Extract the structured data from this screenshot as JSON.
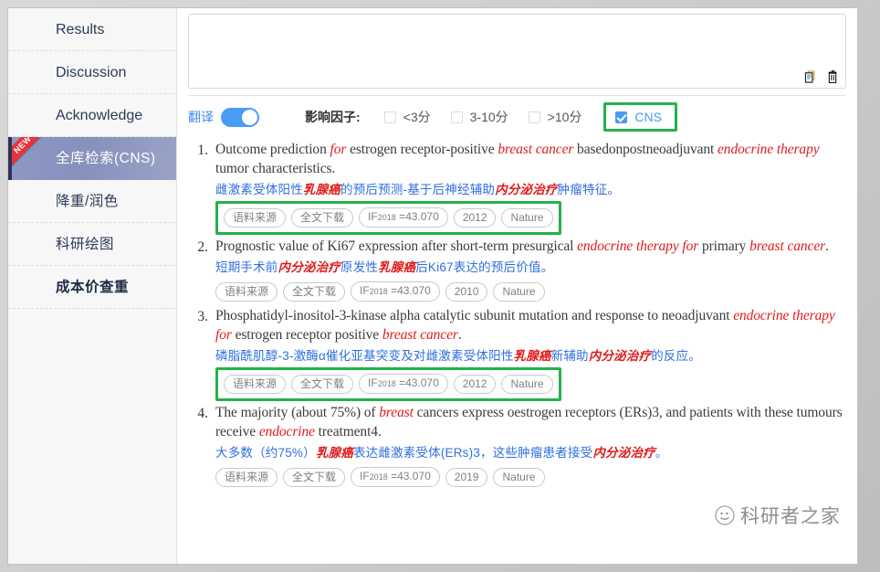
{
  "sidebar": {
    "items": [
      {
        "label": "Results",
        "active": false,
        "badge": "",
        "bold": false,
        "cjk": false
      },
      {
        "label": "Discussion",
        "active": false,
        "badge": "",
        "bold": false,
        "cjk": false
      },
      {
        "label": "Acknowledge",
        "active": false,
        "badge": "",
        "bold": false,
        "cjk": false
      },
      {
        "label": "全库检索(CNS)",
        "active": true,
        "badge": "NEW",
        "bold": false,
        "cjk": true
      },
      {
        "label": "降重/润色",
        "active": false,
        "badge": "",
        "bold": false,
        "cjk": true
      },
      {
        "label": "科研绘图",
        "active": false,
        "badge": "",
        "bold": false,
        "cjk": true
      },
      {
        "label": "成本价查重",
        "active": false,
        "badge": "",
        "bold": true,
        "cjk": true
      }
    ]
  },
  "editor": {
    "value": "",
    "placeholder": "",
    "tools": [
      {
        "name": "copy-icon",
        "title": "copy"
      },
      {
        "name": "delete-icon",
        "title": "delete"
      }
    ]
  },
  "filter_bar": {
    "translate_label": "翻译",
    "translate_on": true,
    "impact_factor_label": "影响因子:",
    "options": [
      {
        "label": "<3分",
        "checked": false,
        "highlighted": false
      },
      {
        "label": "3-10分",
        "checked": false,
        "highlighted": false
      },
      {
        "label": ">10分",
        "checked": false,
        "highlighted": false
      },
      {
        "label": "CNS",
        "checked": true,
        "highlighted": true
      }
    ]
  },
  "results": [
    {
      "number": "1.",
      "title_parts": [
        {
          "t": "Outcome prediction ",
          "hl": false
        },
        {
          "t": "for",
          "hl": true
        },
        {
          "t": " estrogen receptor-positive ",
          "hl": false
        },
        {
          "t": "breast cancer",
          "hl": true
        },
        {
          "t": " basedonpostneoadjuvant ",
          "hl": false
        },
        {
          "t": "endocrine therapy",
          "hl": true
        },
        {
          "t": " tumor characteristics.",
          "hl": false
        }
      ],
      "translation_parts": [
        {
          "t": "雌激素受体阳性",
          "hl": false
        },
        {
          "t": "乳腺癌",
          "hl": true
        },
        {
          "t": "的预后预测-基于后神经辅助",
          "hl": false
        },
        {
          "t": "内分泌治疗",
          "hl": true
        },
        {
          "t": "肿瘤特征。",
          "hl": false
        }
      ],
      "tags": [
        "语料来源",
        "全文下载",
        "IF2018 =43.070",
        "2012",
        "Nature"
      ],
      "tags_highlighted": true
    },
    {
      "number": "2.",
      "title_parts": [
        {
          "t": "Prognostic value of Ki67 expression after short-term presurgical ",
          "hl": false
        },
        {
          "t": "endocrine therapy for",
          "hl": true
        },
        {
          "t": " primary ",
          "hl": false
        },
        {
          "t": "breast cancer",
          "hl": true
        },
        {
          "t": ".",
          "hl": false
        }
      ],
      "translation_parts": [
        {
          "t": "短期手术前",
          "hl": false
        },
        {
          "t": "内分泌治疗",
          "hl": true
        },
        {
          "t": "原发性",
          "hl": false
        },
        {
          "t": "乳腺癌",
          "hl": true
        },
        {
          "t": "后Ki67表达的预后价值。",
          "hl": false
        }
      ],
      "tags": [
        "语料来源",
        "全文下载",
        "IF2018 =43.070",
        "2010",
        "Nature"
      ],
      "tags_highlighted": false
    },
    {
      "number": "3.",
      "title_parts": [
        {
          "t": "Phosphatidyl-inositol-3-kinase alpha catalytic subunit mutation and response to neoadjuvant ",
          "hl": false
        },
        {
          "t": "endocrine therapy for",
          "hl": true
        },
        {
          "t": " estrogen receptor positive ",
          "hl": false
        },
        {
          "t": "breast cancer",
          "hl": true
        },
        {
          "t": ".",
          "hl": false
        }
      ],
      "translation_parts": [
        {
          "t": "磷脂酰肌醇-3-激酶α催化亚基突变及对雌激素受体阳性",
          "hl": false
        },
        {
          "t": "乳腺癌",
          "hl": true
        },
        {
          "t": "新辅助",
          "hl": false
        },
        {
          "t": "内分泌治疗",
          "hl": true
        },
        {
          "t": "的反应。",
          "hl": false
        }
      ],
      "tags": [
        "语料来源",
        "全文下载",
        "IF2018 =43.070",
        "2012",
        "Nature"
      ],
      "tags_highlighted": true
    },
    {
      "number": "4.",
      "title_parts": [
        {
          "t": "The majority (about 75%) of ",
          "hl": false
        },
        {
          "t": "breast",
          "hl": true
        },
        {
          "t": " cancers express oestrogen receptors (ERs)3, and patients with these tumours receive ",
          "hl": false
        },
        {
          "t": "endocrine",
          "hl": true
        },
        {
          "t": " treatment4.",
          "hl": false
        }
      ],
      "translation_parts": [
        {
          "t": "大多数（约75%）",
          "hl": false
        },
        {
          "t": "乳腺癌",
          "hl": true
        },
        {
          "t": "表达雌激素受体(ERs)3，这些肿瘤患者接受",
          "hl": false
        },
        {
          "t": "内分泌治疗",
          "hl": true
        },
        {
          "t": "。",
          "hl": false
        }
      ],
      "tags": [
        "语料来源",
        "全文下载",
        "IF2018 =43.070",
        "2019",
        "Nature"
      ],
      "tags_highlighted": false
    }
  ],
  "watermark": {
    "text": "科研者之家"
  },
  "colors": {
    "accent_blue": "#479bf2",
    "highlight_green": "#24b14a",
    "highlight_red": "#e01b1b",
    "translation_blue": "#2f6fe0",
    "active_item": "#8c99c4",
    "ribbon_red": "#e8333a"
  }
}
